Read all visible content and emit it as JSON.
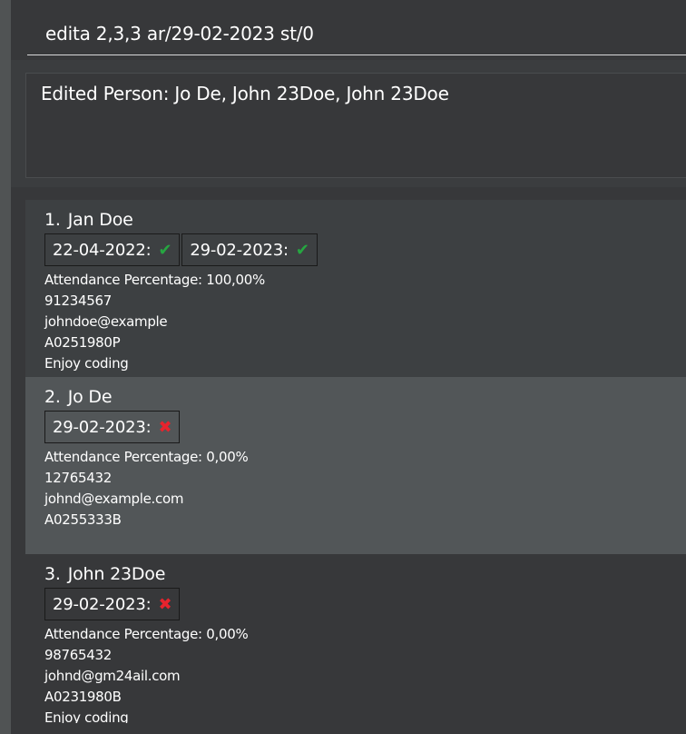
{
  "command": {
    "value": "edita 2,3,3 ar/29-02-2023 st/0"
  },
  "result": {
    "text": "Edited Person: Jo De, John 23Doe, John 23Doe"
  },
  "persons": [
    {
      "index": "1.",
      "name": "Jan Doe",
      "attendance": [
        {
          "date": "22-04-2022:",
          "status": "present",
          "icon": "check-icon",
          "glyph": "✔"
        },
        {
          "date": "29-02-2023:",
          "status": "present",
          "icon": "check-icon",
          "glyph": "✔"
        }
      ],
      "attendance_percentage": "Attendance Percentage: 100,00%",
      "phone": "91234567",
      "email": "johndoe@example",
      "student_id": "A0251980P",
      "remark": "Enjoy coding"
    },
    {
      "index": "2.",
      "name": "Jo De",
      "attendance": [
        {
          "date": "29-02-2023:",
          "status": "absent",
          "icon": "cross-icon",
          "glyph": "✖"
        }
      ],
      "attendance_percentage": "Attendance Percentage: 0,00%",
      "phone": "12765432",
      "email": "johnd@example.com",
      "student_id": "A0255333B",
      "remark": ""
    },
    {
      "index": "3.",
      "name": "John 23Doe",
      "attendance": [
        {
          "date": "29-02-2023:",
          "status": "absent",
          "icon": "cross-icon",
          "glyph": "✖"
        }
      ],
      "attendance_percentage": "Attendance Percentage: 0,00%",
      "phone": "98765432",
      "email": "johnd@gm24ail.com",
      "student_id": "A0231980B",
      "remark": "Enjoy coding"
    }
  ],
  "colors": {
    "present": "#26a641",
    "absent": "#e8232d",
    "selected_card": "#525658"
  }
}
